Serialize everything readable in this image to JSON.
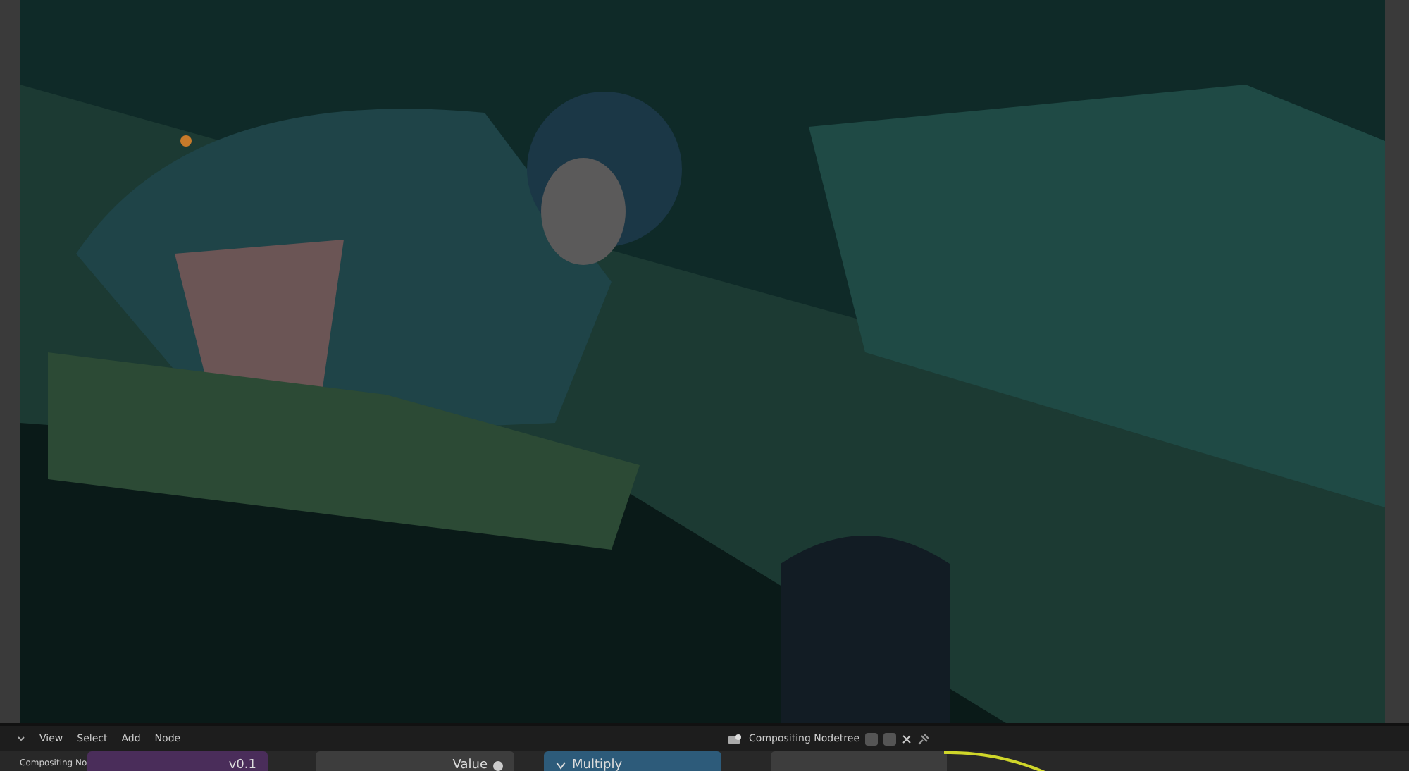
{
  "header": {
    "menus": [
      {
        "label": "View"
      },
      {
        "label": "Select"
      },
      {
        "label": "Add"
      },
      {
        "label": "Node"
      }
    ],
    "nodetree": {
      "name": "Compositing Nodetree",
      "pinned": false
    }
  },
  "editor": {
    "breadcrumb": "Compositing No",
    "nodes": [
      {
        "kind": "group",
        "title": "v0.1"
      },
      {
        "kind": "value",
        "title": "Value"
      },
      {
        "kind": "math",
        "title": "Multiply",
        "expanded": true
      },
      {
        "kind": "plain"
      }
    ]
  }
}
